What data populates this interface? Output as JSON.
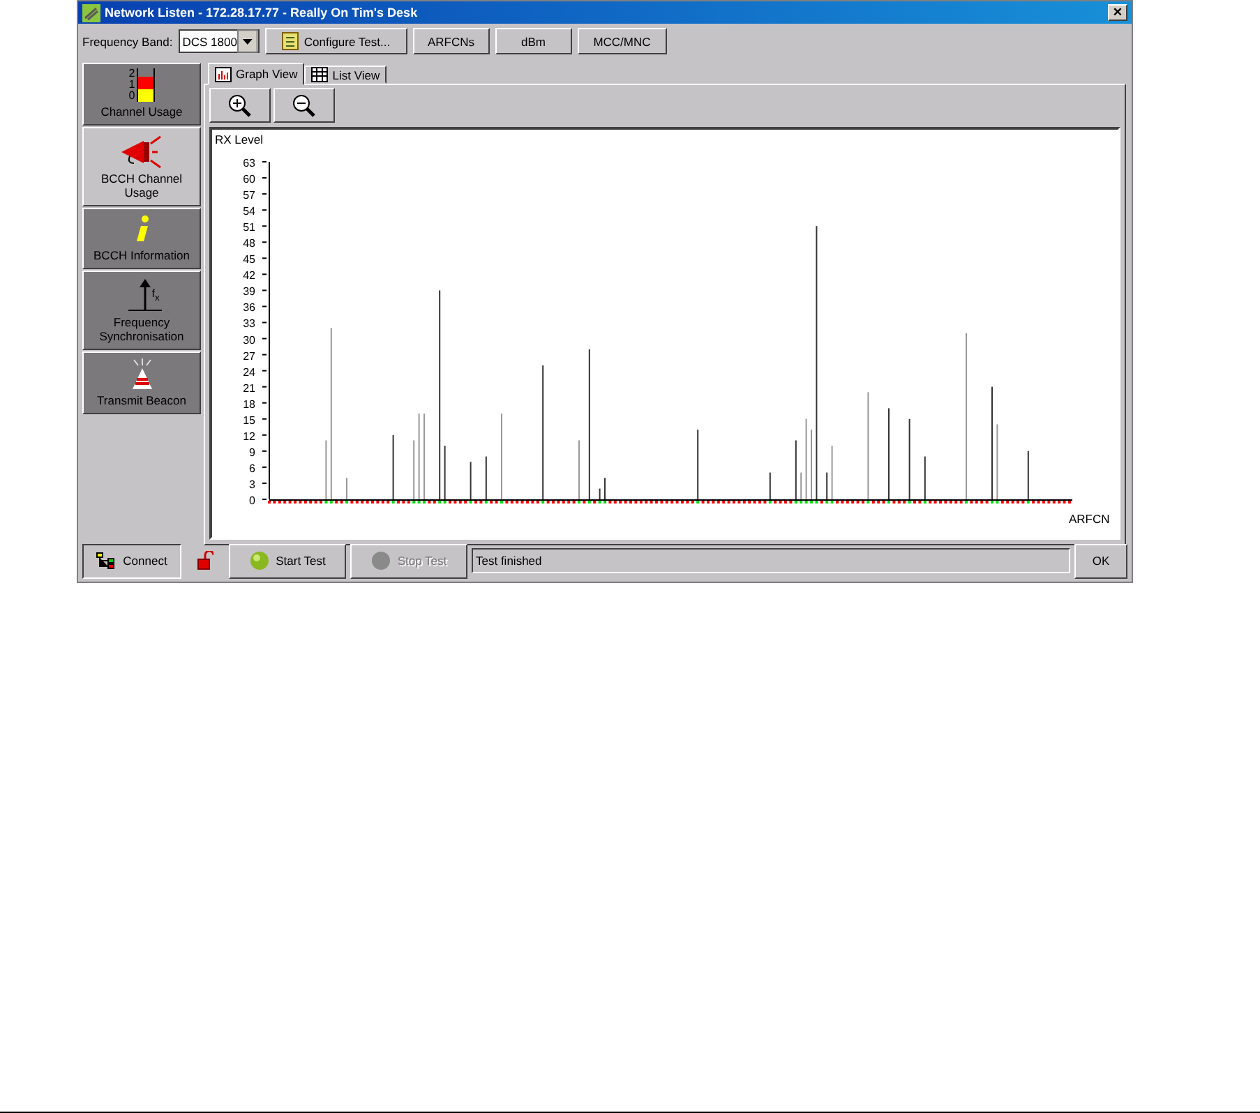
{
  "window": {
    "title": "Network Listen - 172.28.17.77 - Really On Tim's Desk",
    "close": "×"
  },
  "toolbar": {
    "band_label": "Frequency Band:",
    "band_value": "DCS 1800",
    "buttons": [
      "Configure Test...",
      "ARFCNs",
      "dBm",
      "MCC/MNC"
    ]
  },
  "sidebar": {
    "items": [
      {
        "label": "Channel Usage",
        "selected": false,
        "icon_labels": [
          "2",
          "1",
          "0"
        ]
      },
      {
        "label": "BCCH Channel Usage",
        "selected": true
      },
      {
        "label": "BCCH Information",
        "selected": false
      },
      {
        "label": "Frequency Synchronisation",
        "selected": false,
        "icon_labels": [
          "f",
          "x"
        ]
      },
      {
        "label": "Transmit Beacon",
        "selected": false
      }
    ]
  },
  "tabs": [
    {
      "label": "Graph View",
      "selected": true
    },
    {
      "label": "List View",
      "selected": false
    }
  ],
  "chart_data": {
    "type": "bar",
    "xlabel": "ARFCN",
    "ylabel": "RX Level",
    "ylim": [
      0,
      63
    ],
    "yticks": [
      0,
      3,
      6,
      9,
      12,
      15,
      18,
      21,
      24,
      27,
      30,
      33,
      36,
      39,
      42,
      45,
      48,
      51,
      54,
      57,
      60,
      63
    ],
    "categories": [
      null,
      null,
      null,
      null,
      null,
      null,
      null,
      null,
      null,
      null,
      null,
      null,
      null,
      null,
      null,
      null,
      null,
      null,
      null,
      null,
      null,
      null,
      null,
      null,
      null,
      null,
      null,
      null,
      null,
      null,
      null,
      null,
      null,
      null,
      null,
      null,
      null,
      null,
      null,
      null,
      null,
      null,
      null,
      null,
      null,
      null,
      null,
      null,
      null,
      null,
      null,
      null,
      null,
      null,
      null,
      null,
      null,
      null,
      null,
      null,
      null,
      null,
      null,
      null,
      null,
      null,
      null,
      null,
      null,
      null,
      null,
      null,
      null,
      null,
      null,
      null,
      null,
      null,
      null,
      null,
      null,
      null,
      null,
      null,
      null,
      null,
      null,
      null,
      null,
      null,
      null,
      null,
      null,
      null,
      null,
      null,
      null,
      null,
      null,
      null,
      null,
      null,
      null,
      null,
      null,
      null,
      null,
      null,
      null,
      null,
      null,
      null,
      null,
      null,
      null,
      null,
      null,
      null,
      null,
      null,
      null,
      null,
      null,
      null,
      null,
      null,
      null,
      null,
      null,
      null,
      null,
      null,
      null,
      null,
      null,
      null,
      null,
      null,
      null,
      null,
      null,
      null,
      null,
      null,
      null,
      null,
      null,
      null,
      null,
      null,
      null,
      null,
      null,
      null,
      null,
      null
    ],
    "series": [
      {
        "color": "#333333",
        "values": [
          null,
          null,
          null,
          null,
          null,
          null,
          null,
          null,
          null,
          null,
          null,
          null,
          null,
          null,
          null,
          null,
          null,
          null,
          null,
          null,
          null,
          null,
          null,
          null,
          12,
          null,
          null,
          null,
          null,
          null,
          null,
          null,
          null,
          39,
          10,
          null,
          null,
          null,
          null,
          7,
          null,
          null,
          8,
          null,
          null,
          null,
          null,
          null,
          null,
          null,
          null,
          null,
          null,
          25,
          null,
          null,
          null,
          null,
          null,
          null,
          null,
          null,
          28,
          null,
          2,
          4,
          null,
          null,
          null,
          null,
          null,
          null,
          null,
          null,
          null,
          null,
          null,
          null,
          null,
          null,
          null,
          null,
          null,
          13,
          null,
          null,
          null,
          null,
          null,
          null,
          null,
          null,
          null,
          null,
          null,
          null,
          null,
          5,
          null,
          null,
          null,
          null,
          11,
          null,
          null,
          null,
          51,
          null,
          5,
          null,
          null,
          null,
          null,
          null,
          null,
          null,
          null,
          null,
          null,
          null,
          17,
          null,
          null,
          null,
          15,
          null,
          null,
          8,
          null,
          null,
          null,
          null,
          null,
          null,
          null,
          null,
          null,
          null,
          null,
          null,
          21,
          null,
          null,
          null,
          null,
          null,
          null,
          9,
          null,
          null,
          null,
          null,
          null,
          null,
          null,
          null
        ]
      },
      {
        "color": "#999999",
        "values": [
          null,
          null,
          null,
          null,
          null,
          null,
          null,
          null,
          null,
          null,
          null,
          11,
          32,
          null,
          null,
          4,
          null,
          null,
          null,
          null,
          null,
          null,
          null,
          null,
          null,
          null,
          null,
          null,
          11,
          16,
          16,
          null,
          null,
          null,
          null,
          null,
          null,
          null,
          null,
          null,
          null,
          null,
          null,
          null,
          null,
          16,
          null,
          null,
          null,
          null,
          null,
          null,
          null,
          null,
          null,
          null,
          null,
          null,
          null,
          null,
          11,
          null,
          null,
          null,
          null,
          null,
          null,
          null,
          null,
          null,
          null,
          null,
          null,
          null,
          null,
          null,
          null,
          null,
          null,
          null,
          null,
          null,
          null,
          null,
          null,
          null,
          null,
          null,
          null,
          null,
          null,
          null,
          null,
          null,
          null,
          null,
          null,
          null,
          null,
          null,
          null,
          null,
          null,
          5,
          15,
          13,
          null,
          null,
          null,
          10,
          null,
          null,
          null,
          null,
          null,
          null,
          20,
          null,
          null,
          null,
          null,
          null,
          null,
          null,
          null,
          null,
          null,
          null,
          null,
          null,
          null,
          null,
          null,
          null,
          null,
          31,
          null,
          null,
          null,
          null,
          null,
          14,
          null,
          null,
          null,
          null,
          null,
          null,
          null,
          null,
          null,
          null,
          null,
          null,
          null,
          null
        ]
      }
    ]
  },
  "bottom": {
    "connect": "Connect",
    "locked": false,
    "start": "Start Test",
    "stop": "Stop Test",
    "stop_disabled": true,
    "status": "Test finished",
    "ok": "OK"
  }
}
